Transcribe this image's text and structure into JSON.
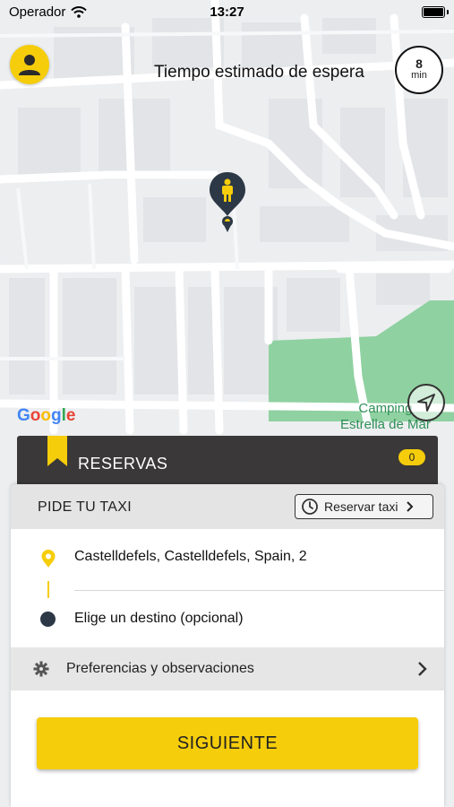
{
  "status_bar": {
    "carrier": "Operador",
    "time": "13:27"
  },
  "header": {
    "wait_label": "Tiempo estimado de espera",
    "wait_value": "8",
    "wait_unit": "min"
  },
  "map": {
    "google_logo": "Google",
    "poi_line1": "Camping",
    "poi_line2": "Estrella de Mar",
    "pin_icon": "person-pin-icon"
  },
  "reservas": {
    "label": "RESERVAS",
    "count": "0"
  },
  "panel": {
    "title": "PIDE TU TAXI",
    "reserve_button": "Reservar taxi",
    "origin": "Castelldefels, Castelldefels, Spain, 2",
    "destination_placeholder": "Elige un destino (opcional)",
    "preferences": "Preferencias y observaciones",
    "next_button": "SIGUIENTE"
  },
  "colors": {
    "accent": "#f5cd0b",
    "dark": "#3a3838",
    "park": "#8fd1a1"
  }
}
